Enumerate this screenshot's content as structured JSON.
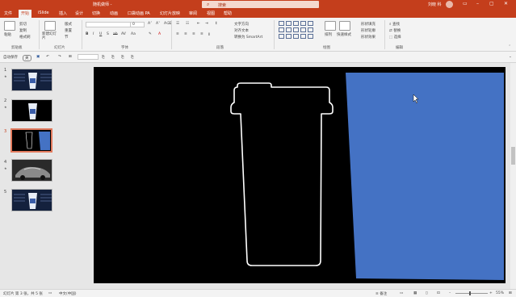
{
  "title": {
    "doc": "随机做师 -",
    "search_placeholder": "搜索",
    "user": "刘晓 科"
  },
  "tabs": [
    "文件",
    "开始",
    "iSlide",
    "插入",
    "设计",
    "切换",
    "动画",
    "口袋动画 PA",
    "幻灯片放映",
    "审阅",
    "视图",
    "帮助"
  ],
  "active_tab_index": 1,
  "ribbon": {
    "clipboard": {
      "paste": "粘贴",
      "cut": "剪切",
      "copy": "复制",
      "format": "格式刷",
      "label": "剪贴板"
    },
    "slides": {
      "new_slide": "新建幻灯片",
      "layout": "版式",
      "reset": "重置",
      "section": "节",
      "label": "幻灯片"
    },
    "font": {
      "label": "字体",
      "size": "0"
    },
    "paragraph": {
      "label": "段落",
      "text_dir": "文字方向",
      "align_text": "对齐文本",
      "smartart": "转换为 SmartArt"
    },
    "drawing": {
      "arrange": "排列",
      "quick_styles": "快速样式",
      "fill": "形状填充",
      "outline": "形状轮廓",
      "effects": "形状效果",
      "label": "绘图"
    },
    "editing": {
      "find": "查找",
      "replace": "替换",
      "select": "选择",
      "label": "编辑"
    }
  },
  "qat": {
    "autosave": "自动保存",
    "autosave_state": "关"
  },
  "slides": [
    {
      "num": "1",
      "star": "★",
      "kind": "cup-blue"
    },
    {
      "num": "2",
      "star": "★",
      "kind": "cup-dark"
    },
    {
      "num": "3",
      "star": "",
      "kind": "outline-blue",
      "selected": true
    },
    {
      "num": "4",
      "star": "★",
      "kind": "car"
    },
    {
      "num": "5",
      "star": "",
      "kind": "cup-blue"
    }
  ],
  "status": {
    "slide_info": "幻灯片 第 3 张，共 5 张",
    "lang": "中文(中国)",
    "notes": "备注",
    "zoom": "55%"
  },
  "colors": {
    "brand": "#c43e1c",
    "shape_fill": "#4472c4",
    "outline": "#ffffff"
  }
}
